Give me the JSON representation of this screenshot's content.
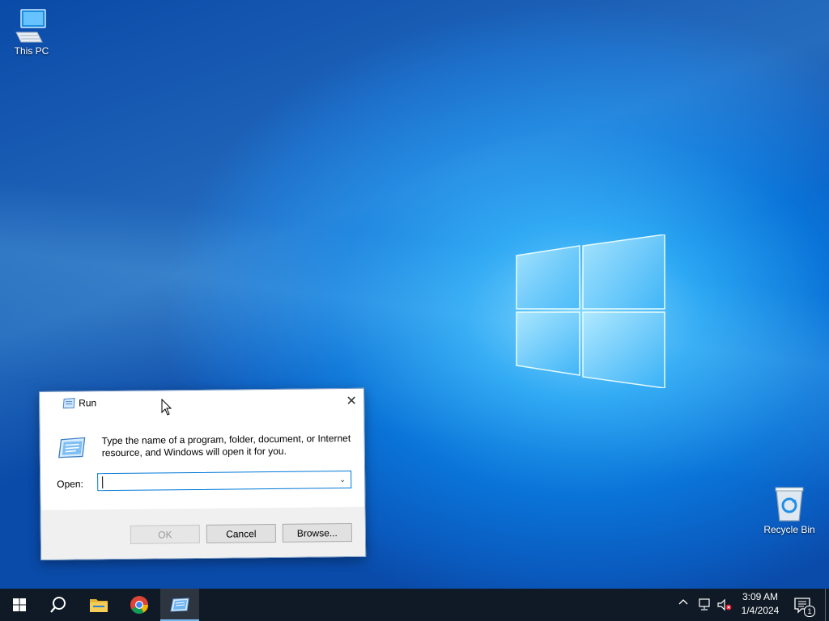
{
  "desktop": {
    "icons": [
      {
        "label": "This PC",
        "icon": "computer-icon"
      },
      {
        "label": "Recycle Bin",
        "icon": "recycle-bin-icon"
      }
    ]
  },
  "run_dialog": {
    "title": "Run",
    "description": "Type the name of a program, folder, document, or Internet resource, and Windows will open it for you.",
    "open_label": "Open:",
    "open_value": "",
    "open_placeholder": "",
    "buttons": {
      "ok": "OK",
      "cancel": "Cancel",
      "browse": "Browse..."
    },
    "close_glyph": "✕"
  },
  "taskbar": {
    "items": [
      {
        "name": "start",
        "icon": "windows-start-icon"
      },
      {
        "name": "search",
        "icon": "search-icon"
      },
      {
        "name": "file-explorer",
        "icon": "folder-icon"
      },
      {
        "name": "chrome",
        "icon": "chrome-icon"
      },
      {
        "name": "run",
        "icon": "run-icon",
        "active": true
      }
    ],
    "tray": {
      "chevron": "^",
      "time": "3:09 AM",
      "date": "1/4/2024",
      "notification_count": "1"
    }
  },
  "colors": {
    "taskbar_bg": "#101a26",
    "accent": "#0078d7",
    "desktop_blue": "#0a74d8"
  }
}
